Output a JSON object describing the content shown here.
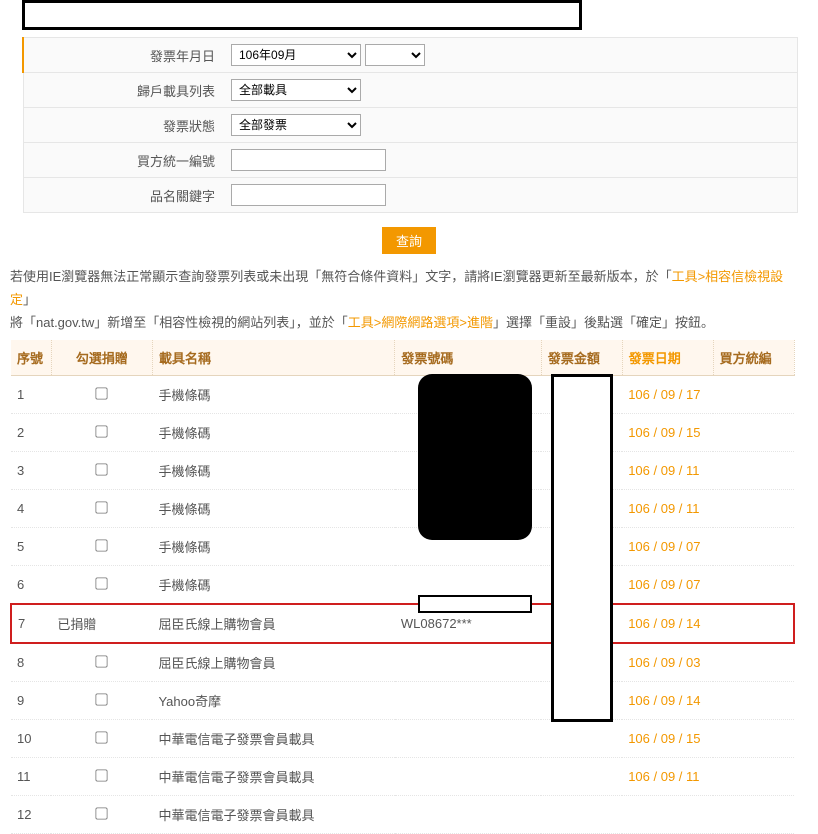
{
  "form": {
    "label_date": "發票年月日",
    "date_year_month": "106年09月",
    "label_carrier": "歸戶載具列表",
    "carrier": "全部載具",
    "label_status": "發票狀態",
    "status": "全部發票",
    "label_buyer_bn": "買方統一編號",
    "buyer_bn": "",
    "label_keyword": "品名關鍵字",
    "keyword": "",
    "btn_query": "查詢"
  },
  "note_segments": {
    "s1": "若使用IE瀏覽器無法正常顯示查詢發票列表或未出現「無符合條件資料」文字，請將IE瀏覽器更新至最新版本，於「",
    "s2": "工具>相容信檢視設定",
    "s3": "」",
    "s4": "將「nat.gov.tw」新增至「相容性檢視的網站列表」，並於「",
    "s5": "工具>網際網路選項>進階",
    "s6": "」選擇「重設」後點選「確定」按鈕。"
  },
  "columns": {
    "seq": "序號",
    "sel": "勾選捐贈",
    "name": "載具名稱",
    "num": "發票號碼",
    "amt": "發票金額",
    "date": "發票日期",
    "bn": "買方統編"
  },
  "rows": [
    {
      "seq": "1",
      "sel": "chk",
      "name": "手機條碼",
      "num": "",
      "date": "106 / 09 / 17"
    },
    {
      "seq": "2",
      "sel": "chk",
      "name": "手機條碼",
      "num": "",
      "date": "106 / 09 / 15"
    },
    {
      "seq": "3",
      "sel": "chk",
      "name": "手機條碼",
      "num": "",
      "date": "106 / 09 / 11"
    },
    {
      "seq": "4",
      "sel": "chk",
      "name": "手機條碼",
      "num": "",
      "date": "106 / 09 / 11"
    },
    {
      "seq": "5",
      "sel": "chk",
      "name": "手機條碼",
      "num": "",
      "date": "106 / 09 / 07"
    },
    {
      "seq": "6",
      "sel": "chk",
      "name": "手機條碼",
      "num": "",
      "date": "106 / 09 / 07"
    },
    {
      "seq": "7",
      "sel": "txt",
      "sel_txt": "已捐贈",
      "name": "屈臣氏線上購物會員",
      "num": "WL08672***",
      "date": "106 / 09 / 14",
      "hl": true
    },
    {
      "seq": "8",
      "sel": "chk",
      "name": "屈臣氏線上購物會員",
      "num": "",
      "date": "106 / 09 / 03"
    },
    {
      "seq": "9",
      "sel": "chk",
      "name": "Yahoo奇摩",
      "num": "",
      "date": "106 / 09 / 14"
    },
    {
      "seq": "10",
      "sel": "chk",
      "name": "中華電信電子發票會員載具",
      "num": "",
      "date": "106 / 09 / 15"
    },
    {
      "seq": "11",
      "sel": "chk",
      "name": "中華電信電子發票會員載具",
      "num": "",
      "date": "106 / 09 / 11"
    },
    {
      "seq": "12",
      "sel": "chk",
      "name": "中華電信電子發票會員載具",
      "num": "",
      "date": ""
    }
  ]
}
